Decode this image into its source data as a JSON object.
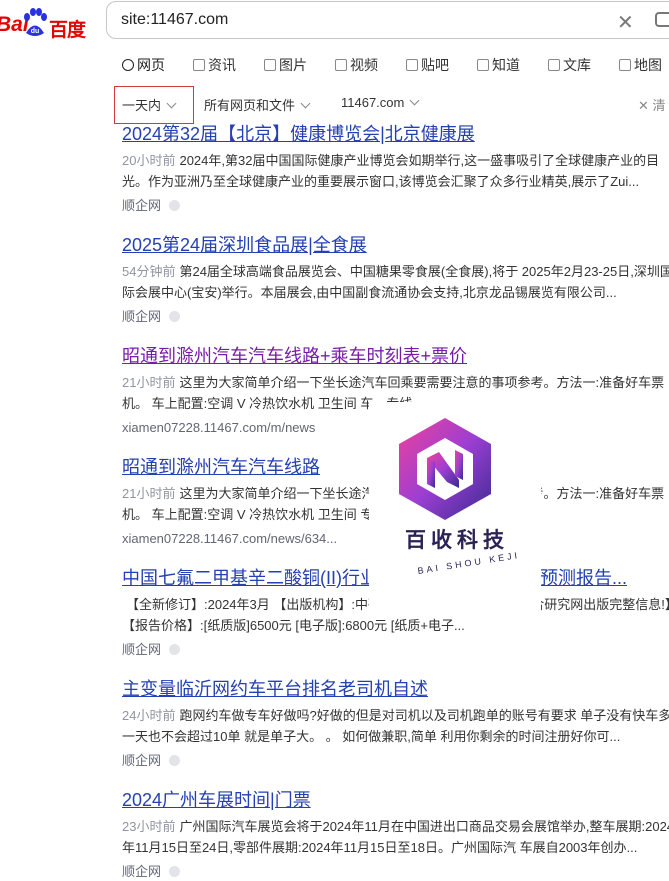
{
  "logo": {
    "part1": "Bai",
    "part2": "百度"
  },
  "search": {
    "query": "site:11467.com"
  },
  "tabs": [
    {
      "label": "网页",
      "icon": "search-icon",
      "active": true
    },
    {
      "label": "资讯",
      "icon": "news-icon"
    },
    {
      "label": "图片",
      "icon": "image-icon"
    },
    {
      "label": "视频",
      "icon": "video-icon"
    },
    {
      "label": "贴吧",
      "icon": "tieba-icon"
    },
    {
      "label": "知道",
      "icon": "question-icon"
    },
    {
      "label": "文库",
      "icon": "document-icon"
    },
    {
      "label": "地图",
      "icon": "map-icon"
    }
  ],
  "filters": {
    "time": "一天内",
    "type": "所有网页和文件",
    "site": "11467.com",
    "clear": "清"
  },
  "results": [
    {
      "title": "2024第32届【北京】健康博览会|北京健康展",
      "time": "20小时前",
      "abstract": "2024年,第32届中国国际健康产业博览会如期举行,这一盛事吸引了全球健康产业的目光。作为亚洲乃至全球健康产业的重要展示窗口,该博览会汇聚了众多行业精英,展示了Zui...",
      "source": "顺企网"
    },
    {
      "title": "2025第24届深圳食品展|全食展",
      "time": "54分钟前",
      "abstract": "第24届全球高端食品展览会、中国糖果零食展(全食展),将于 2025年2月23-25日,深圳国际会展中心(宝安)举行。本届展会,由中国副食流通协会支持,北京龙品锡展览有限公司...",
      "source": "顺企网"
    },
    {
      "title": "昭通到滁州汽车汽车线路+乘车时刻表+票价",
      "time": "21小时前",
      "abstract": "这里为大家简单介绍一下坐长途汽车回乘要需要注意的事项参考。方法一:准备好车票机。 车上配置:空调 V 冷热饮水机 卫生间 车、专线...",
      "source": "xiamen07228.11467.com/m/news"
    },
    {
      "title": "昭通到滁州汽车汽车线路",
      "time": "21小时前",
      "abstract": "这里为大家简单介绍一下坐长途汽车回乘要需要注意的事项参考。方法一:准备好车票机。 车上配置:空调 V 冷热饮水机 卫生间 专线...",
      "source": "xiamen07228.11467.com/news/634..."
    },
    {
      "title": "中国七氟二甲基辛二酸铜(II)行业调研报告及投资前景预测报告...",
      "time": "",
      "abstract": "【全新修订】:2024年3月 【出版机构】:中研网 有删减 详细可参中嘉信合研究网出版完整信息!】 【报告价格】:[纸质版]6500元 [电子版]:6800元 [纸质+电子...",
      "source": "顺企网"
    },
    {
      "title": "主变量临沂网约车平台排名老司机自述",
      "time": "24小时前",
      "abstract": "跑网约车做专车好做吗?好做的但是对司机以及司机跑单的账号有要求 单子没有快车多一天也不会超过10单 就是单子大。 。 如何做兼职,简单 利用你剩余的时间注册好你可...",
      "source": "顺企网"
    },
    {
      "title": "2024广州车展时间|门票",
      "time": "23小时前",
      "abstract": "广州国际汽车展览会将于2024年11月在中国进出口商品交易会展馆举办,整车展期:2024年11月15日至24日,零部件展期:2024年11月15日至18日。广州国际汽 车展自2003年创办...",
      "source": "顺企网"
    }
  ],
  "watermark": {
    "name": "百收科技",
    "sub": "BAI SHOU KEJI",
    "colors": [
      "#e63aa0",
      "#8b3fd0",
      "#3a2a8c"
    ]
  }
}
